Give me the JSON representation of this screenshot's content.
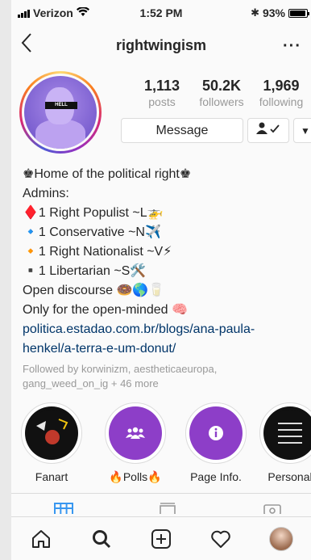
{
  "status_bar": {
    "carrier": "Verizon",
    "time": "1:52 PM",
    "battery": "93%",
    "battery_level": 0.93
  },
  "nav": {
    "back_icon": "chevron-left-icon",
    "title": "rightwingism",
    "more_label": "···"
  },
  "avatar": {
    "text": "HELL"
  },
  "stats": [
    {
      "value": "1,113",
      "label": "posts"
    },
    {
      "value": "50.2K",
      "label": "followers"
    },
    {
      "value": "1,969",
      "label": "following"
    }
  ],
  "actions": {
    "message_label": "Message",
    "follow_icon": "person-check-icon",
    "dropdown_icon": "caret-down-icon"
  },
  "bio": {
    "lines": [
      "♚Home of the political right♚",
      "Admins:",
      "♦️1 Right Populist ~L🚁",
      "🔹1 Conservative ~N✈️",
      "🔸1 Right Nationalist ~V⚡",
      "▪️1 Libertarian ~S🛠️",
      "Open discourse 🍩🌎🥛",
      "Only for the open-minded 🧠"
    ],
    "link_line1": "politica.estadao.com.br/blogs/ana-paula-",
    "link_line2": "henkel/a-terra-e-um-donut/"
  },
  "followed_by": "Followed by korwinizm, aestheticaeuropa, gang_weed_on_ig + 46 more",
  "highlights": [
    {
      "label": "Fanart",
      "icon": "fanart-thumbnail"
    },
    {
      "label": "🔥Polls🔥",
      "icon": "people-icon"
    },
    {
      "label": "Page Info.",
      "icon": "info-icon"
    },
    {
      "label": "Personal",
      "icon": "personal-thumbnail"
    }
  ],
  "tabs": [
    {
      "name": "grid-icon",
      "active": true
    },
    {
      "name": "list-icon",
      "active": false
    },
    {
      "name": "tagged-icon",
      "active": false
    }
  ],
  "bottom_nav": [
    "home-icon",
    "search-icon",
    "add-post-icon",
    "heart-icon",
    "profile-avatar"
  ],
  "colors": {
    "link": "#003569",
    "accent": "#3897f0",
    "highlight": "#8d3ec8",
    "muted": "#999999"
  }
}
